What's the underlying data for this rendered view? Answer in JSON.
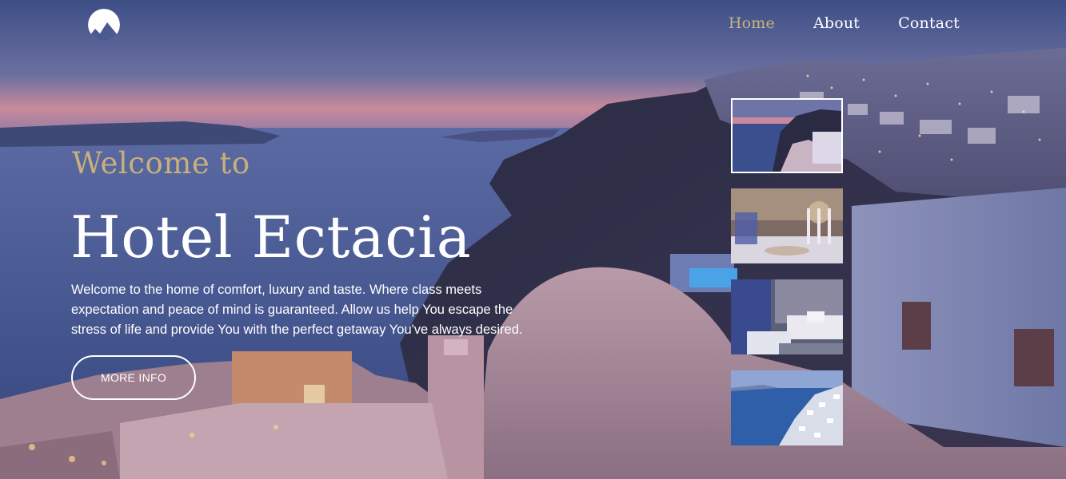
{
  "brand": {
    "logo_icon": "mountain-logo-icon"
  },
  "nav": {
    "items": [
      {
        "label": "Home",
        "active": true
      },
      {
        "label": "About",
        "active": false
      },
      {
        "label": "Contact",
        "active": false
      }
    ]
  },
  "hero": {
    "welcome": "Welcome to",
    "title": "Hotel Ectacia",
    "description": "Welcome to the home of comfort, luxury and taste. Where class meets expectation and peace of mind is guaranteed. Allow us help You escape the stress of life and provide You with the perfect getaway You've always desired.",
    "button_label": "MORE INFO"
  },
  "gallery": {
    "thumbnails": [
      "sea-view-thumbnail",
      "dining-thumbnail",
      "bedroom-thumbnail",
      "cliffside-village-thumbnail"
    ]
  },
  "colors": {
    "accent": "#c9b37e",
    "text": "#ffffff"
  }
}
